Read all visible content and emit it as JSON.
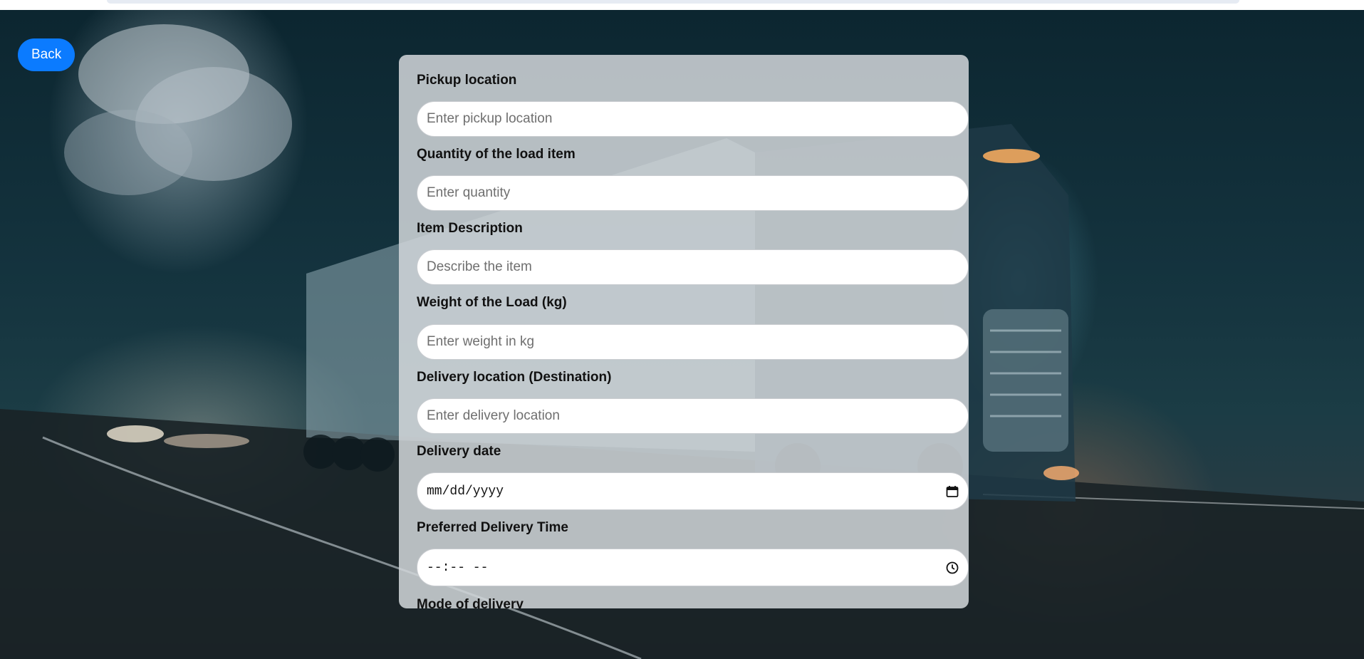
{
  "nav": {
    "back_label": "Back"
  },
  "form": {
    "pickup": {
      "label": "Pickup location",
      "placeholder": "Enter pickup location"
    },
    "quantity": {
      "label": "Quantity of the load item",
      "placeholder": "Enter quantity"
    },
    "description": {
      "label": "Item Description",
      "placeholder": "Describe the item"
    },
    "weight": {
      "label": "Weight of the Load (kg)",
      "placeholder": "Enter weight in kg"
    },
    "delivery_location": {
      "label": "Delivery location (Destination)",
      "placeholder": "Enter delivery location"
    },
    "delivery_date": {
      "label": "Delivery date",
      "value": "mm/dd/yyyy",
      "icon": "calendar-icon"
    },
    "delivery_time": {
      "label": "Preferred Delivery Time",
      "value": "--:-- --",
      "icon": "clock-icon"
    },
    "mode": {
      "label": "Mode of delivery"
    }
  },
  "colors": {
    "accent": "#0b7bff",
    "card": "#d2d6da",
    "background": "#14333e"
  }
}
